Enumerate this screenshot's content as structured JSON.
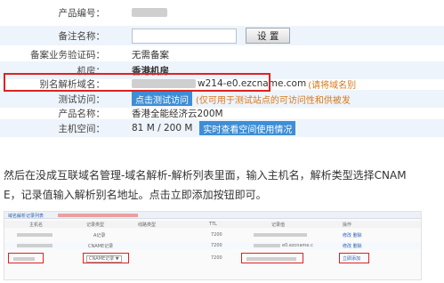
{
  "form": {
    "rows": [
      {
        "label": "产品编号：",
        "type": "blurred"
      },
      {
        "label": "备注名称：",
        "type": "input",
        "button": "设 置"
      },
      {
        "label": "备案业务验证码：",
        "type": "text",
        "value": "无需备案"
      },
      {
        "label": "机房：",
        "type": "text",
        "value": "香港机房"
      },
      {
        "label": "别名解析域名：",
        "type": "alias",
        "value": "w214-e0.ezcname.com",
        "note": "(请将域名别"
      },
      {
        "label": "测试访问：",
        "type": "button",
        "button": "点击测试访问",
        "note": "(仅可用于测试站点的可访问性和供被发"
      },
      {
        "label": "产品名称：",
        "type": "text",
        "value": "香港全能经济云200M"
      },
      {
        "label": "主机空间：",
        "type": "space",
        "value": "81 M / 200 M",
        "button": "实时查看空间使用情况"
      }
    ]
  },
  "instruction": {
    "line1": "然后在没成互联域名管理-域名解析-解析列表里面，输入主机名，解析类型选择CNAM",
    "line2": "E，记录值输入解析别名地址。点击立即添加按钮即可。"
  },
  "dns_table": {
    "header_note": "域名解析记录列表",
    "columns": [
      "主机名",
      "记录类型",
      "线路类型",
      "TTL",
      "记录值",
      "操作"
    ],
    "rows": [
      {
        "type": "A记录",
        "ttl": "7200",
        "action": "修改 删除"
      },
      {
        "type": "CNAME记录",
        "ttl": "7200",
        "value": "e0.ezcname.c",
        "action": "修改 删除"
      },
      {
        "type": "CNAME记录 ▼",
        "ttl": "7200",
        "action": "立即添加"
      }
    ]
  }
}
